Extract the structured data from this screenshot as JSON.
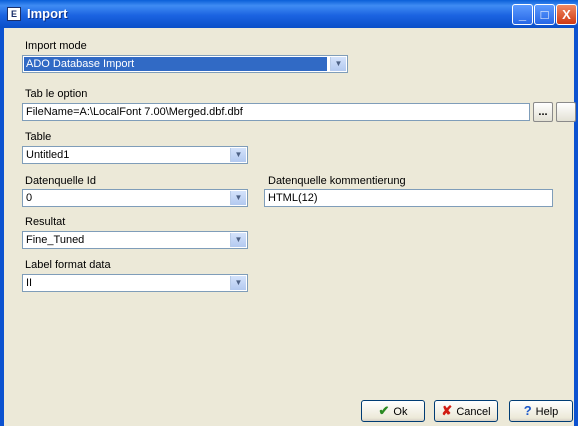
{
  "window": {
    "title": "Import",
    "title_icon": "app-icon",
    "controls": {
      "minimize": "_",
      "maximize": "□",
      "close": "X"
    }
  },
  "form": {
    "import_mode": {
      "label": "Import mode",
      "value": "ADO Database Import"
    },
    "connection": {
      "label": "Tab le option",
      "value": "FileName=A:\\LocalFont 7.00\\Merged.dbf.dbf"
    },
    "connection_buttons": {
      "dots": "...",
      "extra": ""
    },
    "table": {
      "label": "Table",
      "value": "Untitled1"
    },
    "destination": {
      "label": "Datenquelle Id",
      "value": "0"
    },
    "destination_name": {
      "label": "Datenquelle kommentierung",
      "value": "HTML(12)"
    },
    "result": {
      "label": "Resultat",
      "value": "Fine_Tuned"
    },
    "label_format": {
      "label": "Label format data",
      "value": "II"
    }
  },
  "buttons": {
    "ok": {
      "label": "Ok",
      "icon": "✔"
    },
    "cancel": {
      "label": "Cancel",
      "icon": "✘"
    },
    "help": {
      "label": "Help",
      "icon": "?"
    }
  }
}
